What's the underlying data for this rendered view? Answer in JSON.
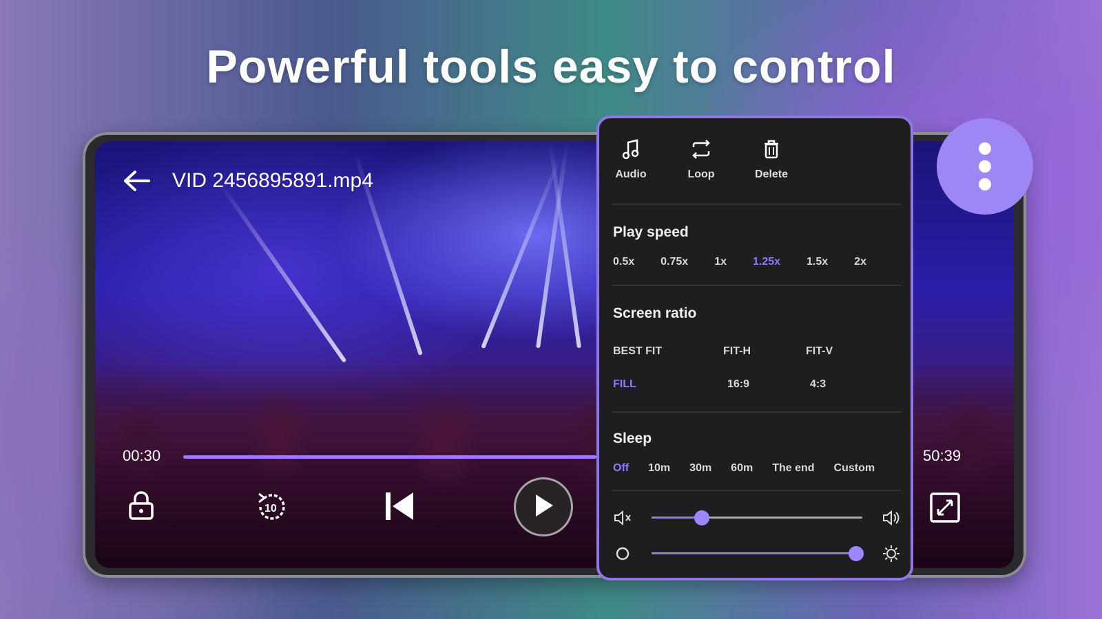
{
  "headline": "Powerful tools easy to control",
  "player": {
    "title": "VID 2456895891.mp4",
    "current_time": "00:30",
    "total_time": "50:39",
    "progress": 0.45,
    "icons": [
      "back-arrow-icon",
      "lock-icon",
      "rewind-10-icon",
      "skip-previous-icon",
      "play-icon",
      "fullscreen-icon",
      "more-vert-icon"
    ],
    "rewind_label": "10"
  },
  "panel": {
    "quick_actions": [
      {
        "label": "Audio",
        "icon": "music-note-icon"
      },
      {
        "label": "Loop",
        "icon": "loop-icon"
      },
      {
        "label": "Delete",
        "icon": "trash-icon"
      }
    ],
    "play_speed": {
      "title": "Play speed",
      "options": [
        "0.5x",
        "0.75x",
        "1x",
        "1.25x",
        "1.5x",
        "2x"
      ],
      "selected": "1.25x"
    },
    "screen_ratio": {
      "title": "Screen ratio",
      "row1": [
        "BEST FIT",
        "FIT-H",
        "FIT-V"
      ],
      "row2": [
        "FILL",
        "16:9",
        "4:3"
      ],
      "selected": "FILL"
    },
    "sleep": {
      "title": "Sleep",
      "options": [
        "Off",
        "10m",
        "30m",
        "60m",
        "The end",
        "Custom"
      ],
      "selected": "Off"
    },
    "volume_level": 0.24,
    "brightness_level": 0.97
  },
  "colors": {
    "accent": "#8f79ff",
    "panel_bg": "#1e1e20",
    "panel_border": "#8d78e6",
    "fab": "#9e86f4"
  }
}
